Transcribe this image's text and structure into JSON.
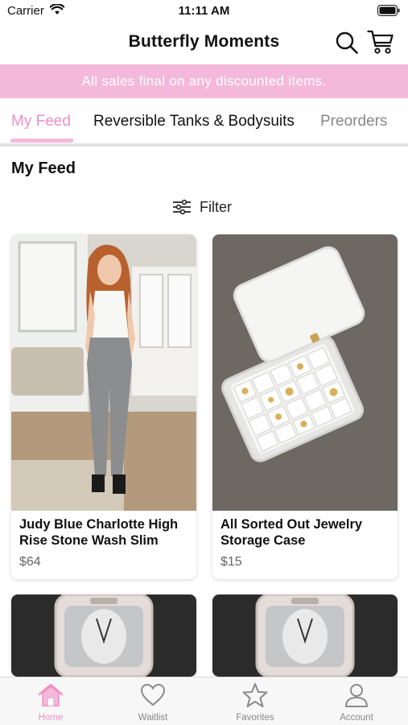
{
  "status_bar": {
    "carrier": "Carrier",
    "time": "11:11 AM"
  },
  "header": {
    "title": "Butterfly Moments"
  },
  "banner": {
    "text": "All sales final on any discounted items."
  },
  "tabs": [
    {
      "label": "My Feed",
      "active": true
    },
    {
      "label": "Reversible Tanks & Bodysuits",
      "active": false
    },
    {
      "label": "Preorders",
      "active": false
    }
  ],
  "section": {
    "title": "My Feed"
  },
  "filter": {
    "label": "Filter"
  },
  "products": [
    {
      "name": "Judy Blue Charlotte High Rise Stone Wash Slim",
      "price": "$64"
    },
    {
      "name": "All Sorted Out Jewelry Storage Case",
      "price": "$15"
    },
    {
      "name": "",
      "price": ""
    },
    {
      "name": "",
      "price": ""
    }
  ],
  "bottom_nav": [
    {
      "label": "Home",
      "icon": "home-icon",
      "active": true
    },
    {
      "label": "Waitlist",
      "icon": "heart-icon",
      "active": false
    },
    {
      "label": "Favorites",
      "icon": "star-icon",
      "active": false
    },
    {
      "label": "Account",
      "icon": "person-icon",
      "active": false
    }
  ],
  "colors": {
    "accent_pink": "#f08ec5",
    "banner_pink": "#f4b8da"
  }
}
